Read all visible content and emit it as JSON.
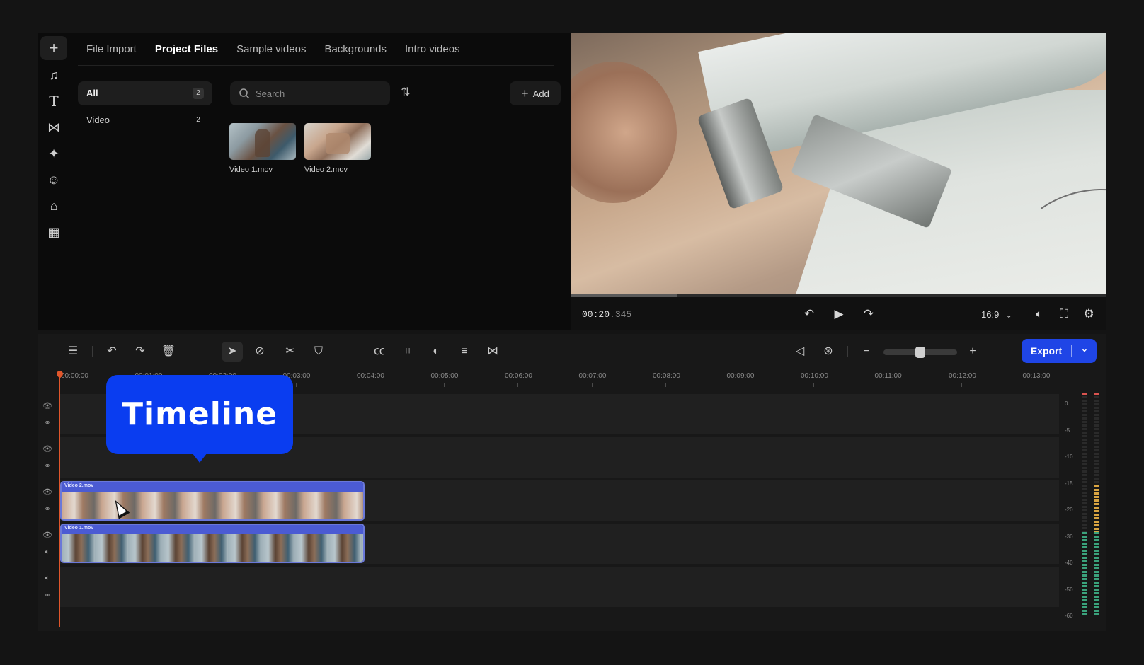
{
  "media": {
    "tabs": [
      "File Import",
      "Project Files",
      "Sample videos",
      "Backgrounds",
      "Intro videos"
    ],
    "active_tab": "Project Files",
    "filters": [
      {
        "label": "All",
        "count": "2"
      },
      {
        "label": "Video",
        "count": "2"
      }
    ],
    "search_placeholder": "Search",
    "add_label": "Add",
    "files": [
      {
        "name": "Video 1.mov"
      },
      {
        "name": "Video 2.mov"
      }
    ]
  },
  "rail_icons": [
    "plus-icon",
    "music-icon",
    "text-icon",
    "transition-icon",
    "effects-icon",
    "sticker-icon",
    "brand-kit-icon",
    "apps-icon"
  ],
  "player": {
    "timecode_main": "00:20",
    "timecode_ms": ".345",
    "aspect_ratio": "16:9",
    "progress": 0.2
  },
  "timeline": {
    "export_label": "Export",
    "ruler_ticks": [
      "00:00:00",
      "00:01:00",
      "00:02:00",
      "00:03:00",
      "00:04:00",
      "00:05:00",
      "00:06:00",
      "00:07:00",
      "00:08:00",
      "00:09:00",
      "00:10:00",
      "00:11:00",
      "00:12:00",
      "00:13:00"
    ],
    "clips": [
      {
        "name": "Video 2.mov"
      },
      {
        "name": "Video 1.mov"
      }
    ],
    "meter_db": [
      "0",
      "-5",
      "-10",
      "-15",
      "-20",
      "-30",
      "-40",
      "-50",
      "-60"
    ],
    "zoom_level": 0.5
  },
  "callout": {
    "text": "Timeline"
  },
  "colors": {
    "accent": "#1f45e6",
    "callout": "#0a3df0",
    "playhead": "#e0562b",
    "clip": "#4b5bd3"
  }
}
